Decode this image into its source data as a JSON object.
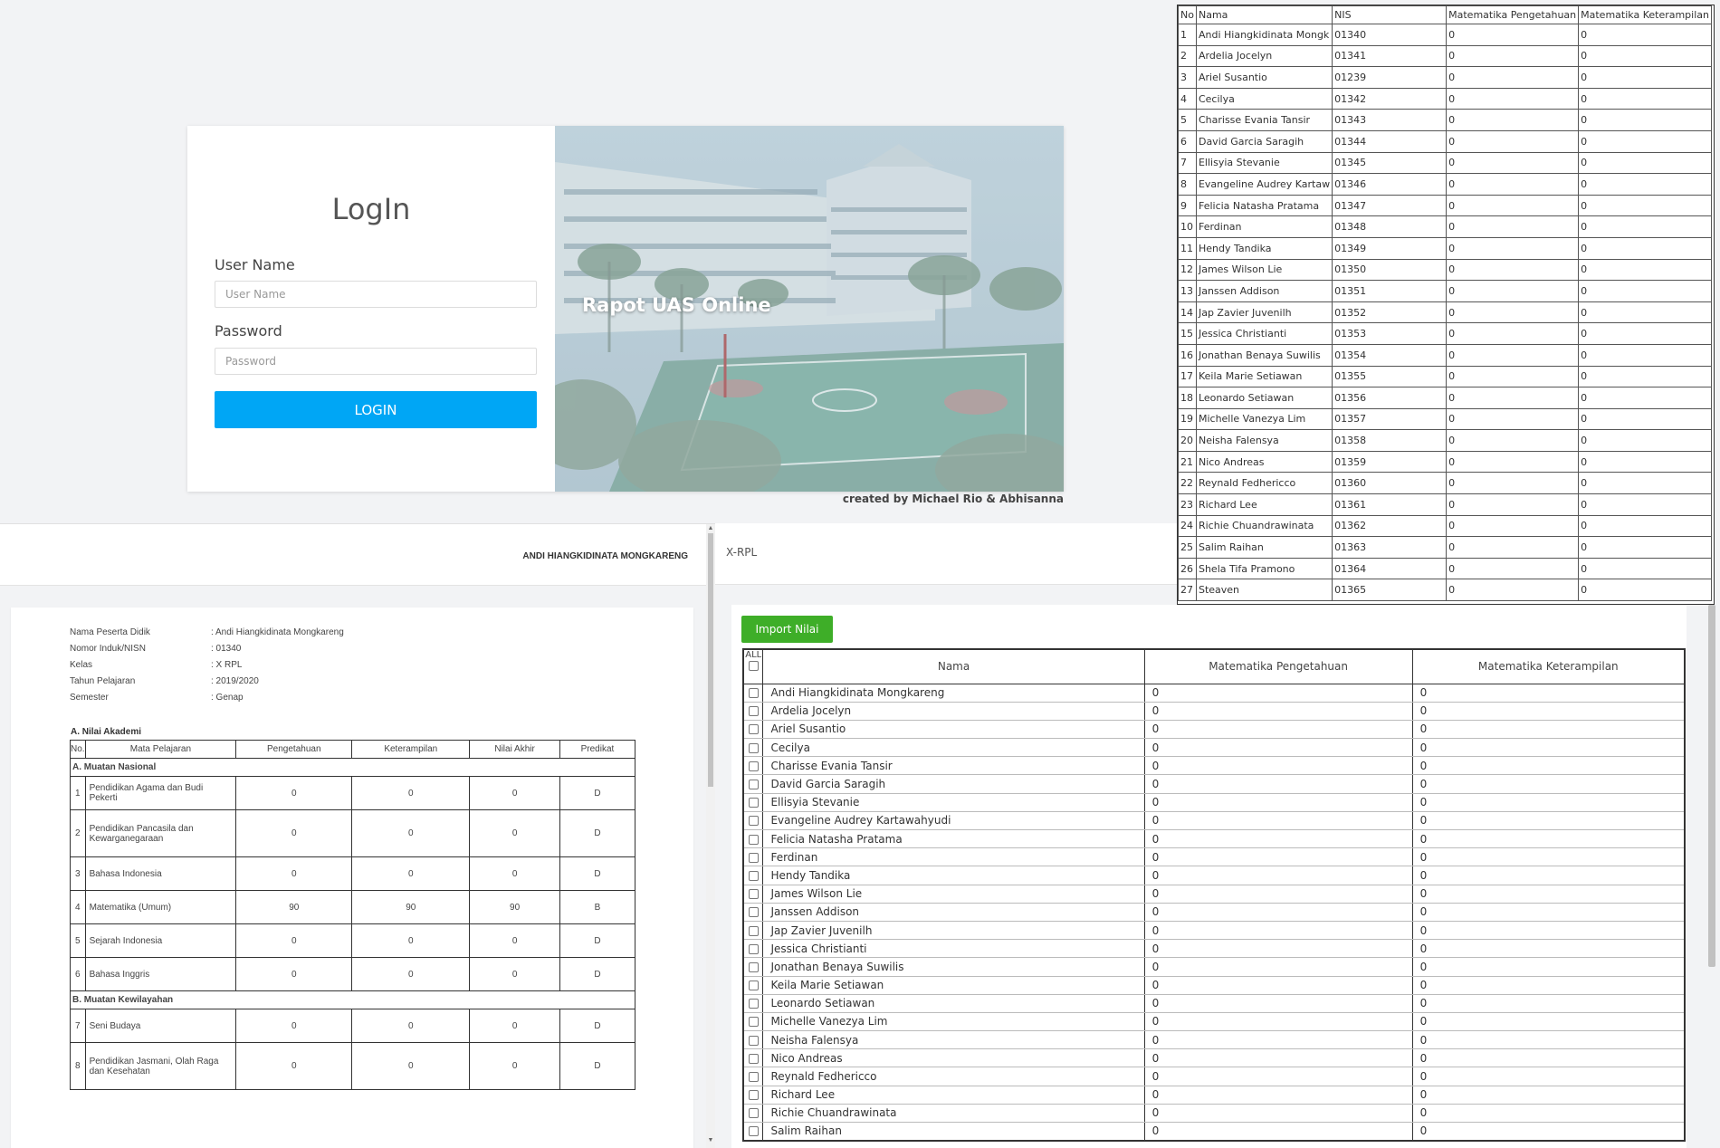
{
  "login": {
    "title": "LogIn",
    "username_label": "User Name",
    "username_placeholder": "User Name",
    "password_label": "Password",
    "password_placeholder": "Password",
    "button_label": "LOGIN",
    "hero_title": "Rapot UAS Online",
    "credit": "created by Michael Rio & Abhisanna",
    "accent_color": "#00a6f5"
  },
  "report": {
    "header_user": "ANDI HIANGKIDINATA MONGKARENG",
    "info": [
      {
        "label": "Nama Peserta Didik",
        "value": ": Andi Hiangkidinata Mongkareng"
      },
      {
        "label": "Nomor Induk/NISN",
        "value": ": 01340"
      },
      {
        "label": "Kelas",
        "value": ": X RPL"
      },
      {
        "label": "Tahun Pelajaran",
        "value": ": 2019/2020"
      },
      {
        "label": "Semester",
        "value": ": Genap"
      }
    ],
    "section_title": "A. Nilai Akademi",
    "columns": [
      "No.",
      "Mata Pelajaran",
      "Pengetahuan",
      "Keterampilan",
      "Nilai Akhir",
      "Predikat"
    ],
    "group_a": "A. Muatan Nasional",
    "group_b": "B. Muatan Kewilayahan",
    "rows_a": [
      {
        "no": "1",
        "subject": "Pendidikan Agama dan Budi Pekerti",
        "p": "0",
        "k": "0",
        "n": "0",
        "pred": "D"
      },
      {
        "no": "2",
        "subject": "Pendidikan Pancasila dan Kewarganegaraan",
        "p": "0",
        "k": "0",
        "n": "0",
        "pred": "D"
      },
      {
        "no": "3",
        "subject": "Bahasa Indonesia",
        "p": "0",
        "k": "0",
        "n": "0",
        "pred": "D"
      },
      {
        "no": "4",
        "subject": "Matematika (Umum)",
        "p": "90",
        "k": "90",
        "n": "90",
        "pred": "B"
      },
      {
        "no": "5",
        "subject": "Sejarah Indonesia",
        "p": "0",
        "k": "0",
        "n": "0",
        "pred": "D"
      },
      {
        "no": "6",
        "subject": "Bahasa Inggris",
        "p": "0",
        "k": "0",
        "n": "0",
        "pred": "D"
      }
    ],
    "rows_b": [
      {
        "no": "7",
        "subject": "Seni Budaya",
        "p": "0",
        "k": "0",
        "n": "0",
        "pred": "D"
      },
      {
        "no": "8",
        "subject": "Pendidikan Jasmani, Olah Raga dan Kesehatan",
        "p": "0",
        "k": "0",
        "n": "0",
        "pred": "D"
      }
    ]
  },
  "class_bar": {
    "label": "X-RPL"
  },
  "grade_list": {
    "columns": [
      "No",
      "Nama",
      "NIS",
      "Matematika Pengetahuan",
      "Matematika Keterampilan"
    ],
    "rows": [
      [
        "1",
        "Andi Hiangkidinata Mongk",
        "01340",
        "0",
        "0"
      ],
      [
        "2",
        "Ardelia Jocelyn",
        "01341",
        "0",
        "0"
      ],
      [
        "3",
        "Ariel Susantio",
        "01239",
        "0",
        "0"
      ],
      [
        "4",
        "Cecilya",
        "01342",
        "0",
        "0"
      ],
      [
        "5",
        "Charisse Evania Tansir",
        "01343",
        "0",
        "0"
      ],
      [
        "6",
        "David Garcia Saragih",
        "01344",
        "0",
        "0"
      ],
      [
        "7",
        "Ellisyia Stevanie",
        "01345",
        "0",
        "0"
      ],
      [
        "8",
        "Evangeline Audrey Kartaw",
        "01346",
        "0",
        "0"
      ],
      [
        "9",
        "Felicia Natasha Pratama",
        "01347",
        "0",
        "0"
      ],
      [
        "10",
        "Ferdinan",
        "01348",
        "0",
        "0"
      ],
      [
        "11",
        "Hendy Tandika",
        "01349",
        "0",
        "0"
      ],
      [
        "12",
        "James Wilson Lie",
        "01350",
        "0",
        "0"
      ],
      [
        "13",
        "Janssen Addison",
        "01351",
        "0",
        "0"
      ],
      [
        "14",
        "Jap Zavier Juvenilh",
        "01352",
        "0",
        "0"
      ],
      [
        "15",
        "Jessica Christianti",
        "01353",
        "0",
        "0"
      ],
      [
        "16",
        "Jonathan Benaya Suwilis",
        "01354",
        "0",
        "0"
      ],
      [
        "17",
        "Keila Marie Setiawan",
        "01355",
        "0",
        "0"
      ],
      [
        "18",
        "Leonardo Setiawan",
        "01356",
        "0",
        "0"
      ],
      [
        "19",
        "Michelle Vanezya Lim",
        "01357",
        "0",
        "0"
      ],
      [
        "20",
        "Neisha Falensya",
        "01358",
        "0",
        "0"
      ],
      [
        "21",
        "Nico Andreas",
        "01359",
        "0",
        "0"
      ],
      [
        "22",
        "Reynald Fedhericco",
        "01360",
        "0",
        "0"
      ],
      [
        "23",
        "Richard Lee",
        "01361",
        "0",
        "0"
      ],
      [
        "24",
        "Richie Chuandrawinata",
        "01362",
        "0",
        "0"
      ],
      [
        "25",
        "Salim Raihan",
        "01363",
        "0",
        "0"
      ],
      [
        "26",
        "Shela Tifa Pramono",
        "01364",
        "0",
        "0"
      ],
      [
        "27",
        "Steaven",
        "01365",
        "0",
        "0"
      ]
    ]
  },
  "import": {
    "button_label": "Import Nilai",
    "button_color": "#3eae28",
    "all_label": "ALL",
    "columns": [
      "Nama",
      "Matematika Pengetahuan",
      "Matematika Keterampilan"
    ],
    "rows": [
      [
        "Andi Hiangkidinata Mongkareng",
        "0",
        "0"
      ],
      [
        "Ardelia Jocelyn",
        "0",
        "0"
      ],
      [
        "Ariel Susantio",
        "0",
        "0"
      ],
      [
        "Cecilya",
        "0",
        "0"
      ],
      [
        "Charisse Evania Tansir",
        "0",
        "0"
      ],
      [
        "David Garcia Saragih",
        "0",
        "0"
      ],
      [
        "Ellisyia Stevanie",
        "0",
        "0"
      ],
      [
        "Evangeline Audrey Kartawahyudi",
        "0",
        "0"
      ],
      [
        "Felicia Natasha Pratama",
        "0",
        "0"
      ],
      [
        "Ferdinan",
        "0",
        "0"
      ],
      [
        "Hendy Tandika",
        "0",
        "0"
      ],
      [
        "James Wilson Lie",
        "0",
        "0"
      ],
      [
        "Janssen Addison",
        "0",
        "0"
      ],
      [
        "Jap Zavier Juvenilh",
        "0",
        "0"
      ],
      [
        "Jessica Christianti",
        "0",
        "0"
      ],
      [
        "Jonathan Benaya Suwilis",
        "0",
        "0"
      ],
      [
        "Keila Marie Setiawan",
        "0",
        "0"
      ],
      [
        "Leonardo Setiawan",
        "0",
        "0"
      ],
      [
        "Michelle Vanezya Lim",
        "0",
        "0"
      ],
      [
        "Neisha Falensya",
        "0",
        "0"
      ],
      [
        "Nico Andreas",
        "0",
        "0"
      ],
      [
        "Reynald Fedhericco",
        "0",
        "0"
      ],
      [
        "Richard Lee",
        "0",
        "0"
      ],
      [
        "Richie Chuandrawinata",
        "0",
        "0"
      ],
      [
        "Salim Raihan",
        "0",
        "0"
      ]
    ]
  }
}
